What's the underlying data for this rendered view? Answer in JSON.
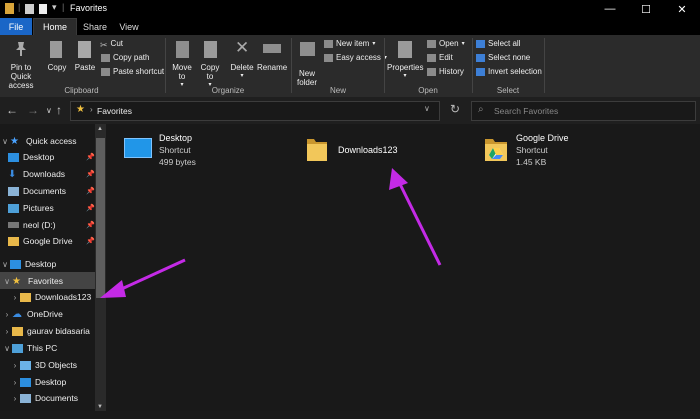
{
  "window": {
    "title": "Favorites",
    "controls": {
      "minimize": "—",
      "maximize": "☐",
      "close": "✕"
    }
  },
  "tabs": [
    "File",
    "Home",
    "Share",
    "View"
  ],
  "ribbon": {
    "clipboard": {
      "pin_label": "Pin to Quick access",
      "copy_label": "Copy",
      "paste_label": "Paste",
      "cut_label": "Cut",
      "copy_path_label": "Copy path",
      "paste_shortcut_label": "Paste shortcut",
      "group_label": "Clipboard"
    },
    "organize": {
      "move_to_label": "Move to",
      "copy_to_label": "Copy to",
      "delete_label": "Delete",
      "rename_label": "Rename",
      "group_label": "Organize"
    },
    "new": {
      "new_folder_label": "New folder",
      "new_item_label": "New item",
      "easy_access_label": "Easy access",
      "group_label": "New"
    },
    "open": {
      "properties_label": "Properties",
      "open_label": "Open",
      "edit_label": "Edit",
      "history_label": "History",
      "group_label": "Open"
    },
    "select": {
      "select_all_label": "Select all",
      "select_none_label": "Select none",
      "invert_label": "Invert selection",
      "group_label": "Select"
    }
  },
  "address": {
    "path": "Favorites",
    "search_placeholder": "Search Favorites"
  },
  "nav": {
    "quick_access": "Quick access",
    "items": [
      "Desktop",
      "Downloads",
      "Documents",
      "Pictures",
      "neol (D:)",
      "Google Drive"
    ],
    "desktop": "Desktop",
    "favorites": "Favorites",
    "downloads123": "Downloads123",
    "onedrive": "OneDrive",
    "user": "gaurav bidasaria",
    "this_pc": "This PC",
    "pc_items": [
      "3D Objects",
      "Desktop",
      "Documents"
    ]
  },
  "files": [
    {
      "name": "Desktop",
      "type": "Shortcut",
      "size": "499 bytes"
    },
    {
      "name": "Downloads123"
    },
    {
      "name": "Google Drive",
      "type": "Shortcut",
      "size": "1.45 KB"
    }
  ],
  "colors": {
    "accent": "#1a66c7",
    "annotation": "#c42ae6",
    "folder": "#e8b84a"
  }
}
